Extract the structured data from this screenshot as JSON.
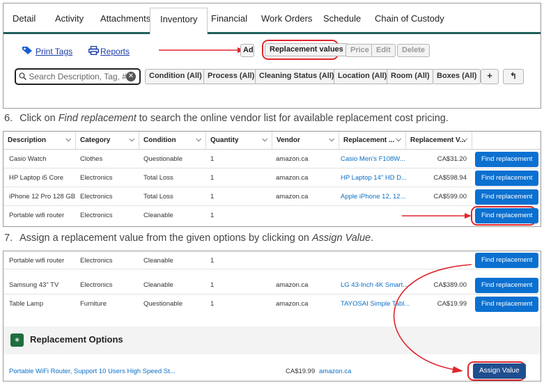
{
  "tabs": [
    "Detail",
    "Activity",
    "Attachments",
    "Inventory",
    "Financial",
    "Work Orders",
    "Schedule",
    "Chain of Custody"
  ],
  "active_tab": "Inventory",
  "toolbar": {
    "print_tags": "Print Tags",
    "reports": "Reports",
    "add": "Add",
    "replacement_values": "Replacement values",
    "price": "Price",
    "edit": "Edit",
    "delete": "Delete"
  },
  "filters": {
    "search_placeholder": "Search Description, Tag, #...",
    "pills": [
      "Condition (All)",
      "Process (All)",
      "Cleaning Status (All)",
      "Location (All)",
      "Room (All)",
      "Boxes (All)"
    ],
    "plus_icon": "+",
    "undo_icon": "↰"
  },
  "step6": {
    "num": "6.",
    "pre": "Click on ",
    "em": "Find replacement",
    "post": " to search the online vendor list for available replacement cost pricing."
  },
  "step7": {
    "num": "7.",
    "pre": "Assign a replacement value from the given options by clicking on ",
    "em": "Assign Value",
    "post": "."
  },
  "table": {
    "headers": [
      "Description",
      "Category",
      "Condition",
      "Quantity",
      "Vendor",
      "Replacement ...",
      "Replacement V..."
    ],
    "rows": [
      {
        "desc": "Casio Watch",
        "cat": "Clothes",
        "cond": "Questionable",
        "qty": "1",
        "vendor": "amazon.ca",
        "repl": "Casio Men's F108W...",
        "val": "CA$31.20",
        "btn": "Find replacement"
      },
      {
        "desc": "HP Laptop i5 Core",
        "cat": "Electronics",
        "cond": "Total Loss",
        "qty": "1",
        "vendor": "amazon.ca",
        "repl": "HP Laptop 14\" HD D...",
        "val": "CA$598.94",
        "btn": "Find replacement"
      },
      {
        "desc": "iPhone 12 Pro 128 GB",
        "cat": "Electronics",
        "cond": "Total Loss",
        "qty": "1",
        "vendor": "amazon.ca",
        "repl": "Apple iPhone 12, 12...",
        "val": "CA$599.00",
        "btn": "Find replacement"
      },
      {
        "desc": "Portable wifi router",
        "cat": "Electronics",
        "cond": "Cleanable",
        "qty": "1",
        "vendor": "",
        "repl": "",
        "val": "",
        "btn": "Find replacement"
      }
    ]
  },
  "table2": {
    "rows": [
      {
        "desc": "Portable wifi router",
        "cat": "Electronics",
        "cond": "Cleanable",
        "qty": "1",
        "vendor": "",
        "repl": "",
        "val": "",
        "btn": "Find replacement"
      },
      {
        "desc": "Samsung 43\" TV",
        "cat": "Electronics",
        "cond": "Cleanable",
        "qty": "1",
        "vendor": "amazon.ca",
        "repl": "LG 43-Inch 4K Smart...",
        "val": "CA$389.00",
        "btn": "Find replacement"
      },
      {
        "desc": "Table Lamp",
        "cat": "Furniture",
        "cond": "Questionable",
        "qty": "1",
        "vendor": "amazon.ca",
        "repl": "TAYOSAI Simple Tabl...",
        "val": "CA$19.99",
        "btn": "Find replacement"
      }
    ]
  },
  "replacement_options": {
    "title": "Replacement Options",
    "item": "Portable WiFi Router, Support 10 Users High Speed St...",
    "price": "CA$19.99",
    "vendor": "amazon.ca",
    "button": "Assign Value"
  },
  "colors": {
    "accent": "#0b70d0",
    "highlight": "#e0262e",
    "tab_underline": "#1f5f5b",
    "assign": "#1f4e8f"
  }
}
